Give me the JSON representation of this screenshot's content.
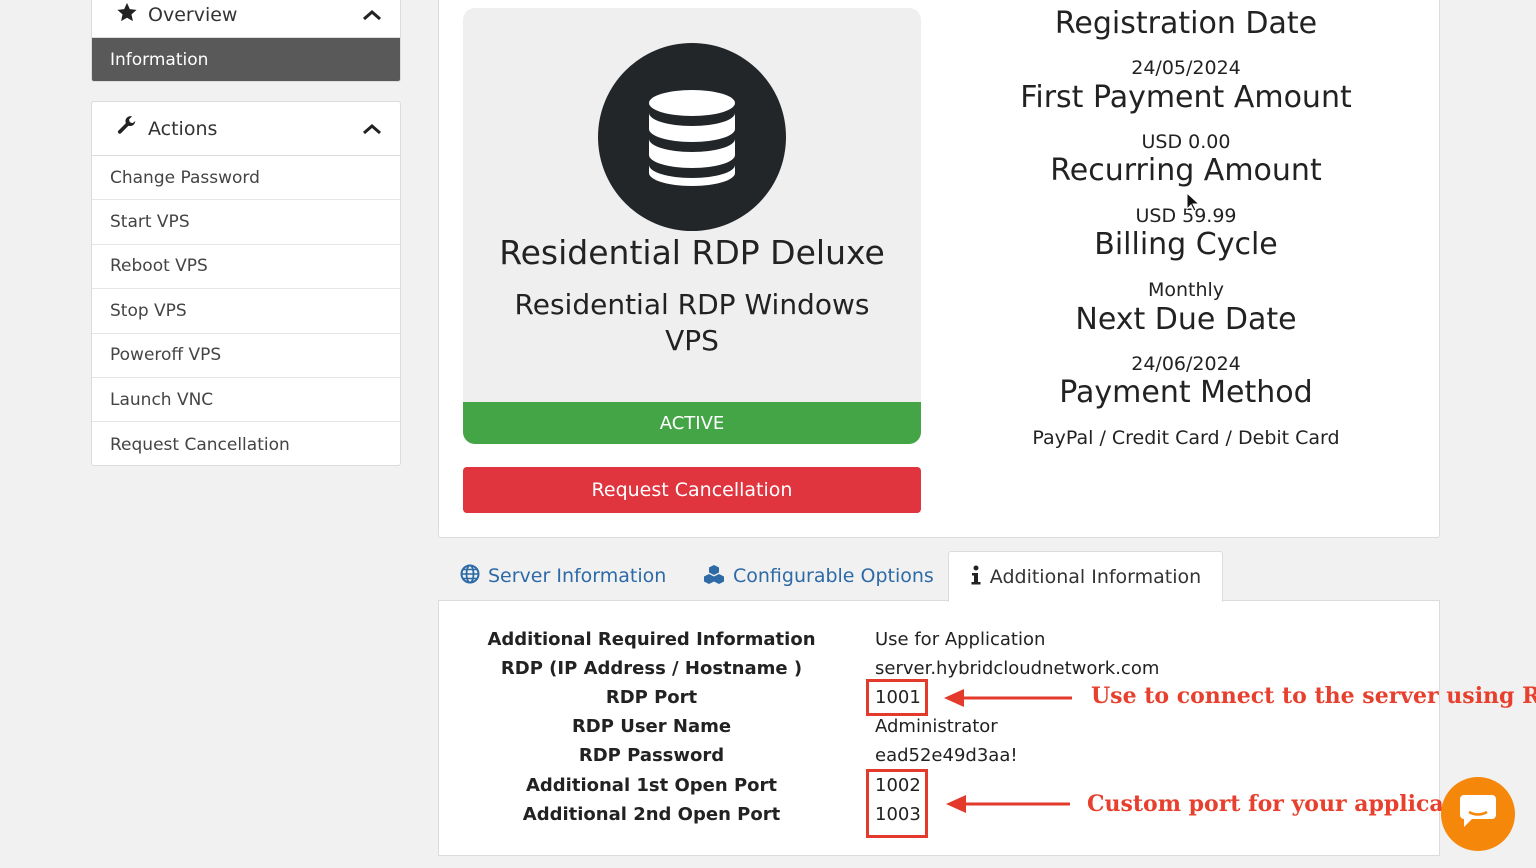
{
  "sidebar": {
    "overview": {
      "title": "Overview",
      "active_item": "Information"
    },
    "actions": {
      "title": "Actions",
      "items": [
        "Change Password",
        "Start VPS",
        "Reboot VPS",
        "Stop VPS",
        "Poweroff VPS",
        "Launch VNC",
        "Request Cancellation"
      ]
    }
  },
  "product": {
    "name": "Residential RDP Deluxe",
    "group": "Residential RDP Windows VPS",
    "status": "ACTIVE",
    "cancel_label": "Request Cancellation"
  },
  "billing": {
    "registration_date_label": "Registration Date",
    "registration_date": "24/05/2024",
    "first_payment_label": "First Payment Amount",
    "first_payment": "USD 0.00",
    "recurring_label": "Recurring Amount",
    "recurring": "USD 59.99",
    "billing_cycle_label": "Billing Cycle",
    "billing_cycle": "Monthly",
    "next_due_label": "Next Due Date",
    "next_due": "24/06/2024",
    "payment_method_label": "Payment Method",
    "payment_method": "PayPal / Credit Card / Debit Card"
  },
  "tabs": {
    "server_info": "Server Information",
    "configurable": "Configurable Options",
    "additional": "Additional Information"
  },
  "details": {
    "rows": [
      {
        "label": "Additional Required Information",
        "value": "Use for Application"
      },
      {
        "label": "RDP (IP Address / Hostname )",
        "value": "server.hybridcloudnetwork.com"
      },
      {
        "label": "RDP Port",
        "value": "1001"
      },
      {
        "label": "RDP User Name",
        "value": "Administrator"
      },
      {
        "label": "RDP Password",
        "value": "ead52e49d3aa!"
      },
      {
        "label": "Additional 1st Open Port",
        "value": "1002"
      },
      {
        "label": "Additional 2nd Open Port",
        "value": "1003"
      }
    ]
  },
  "annotations": {
    "rdp_note": "Use to connect to the server using RDP",
    "custom_note": "Custom port for your application"
  },
  "colors": {
    "active_green": "#44a547",
    "cancel_red": "#e0343f",
    "annotation_red": "#e8402e",
    "link_blue": "#2d6aa6",
    "chat_orange": "#f5870a"
  },
  "icons": [
    "star-icon",
    "chevron-up-icon",
    "wrench-icon",
    "database-icon",
    "globe-icon",
    "cubes-icon",
    "info-icon",
    "chat-icon",
    "cursor-icon"
  ]
}
